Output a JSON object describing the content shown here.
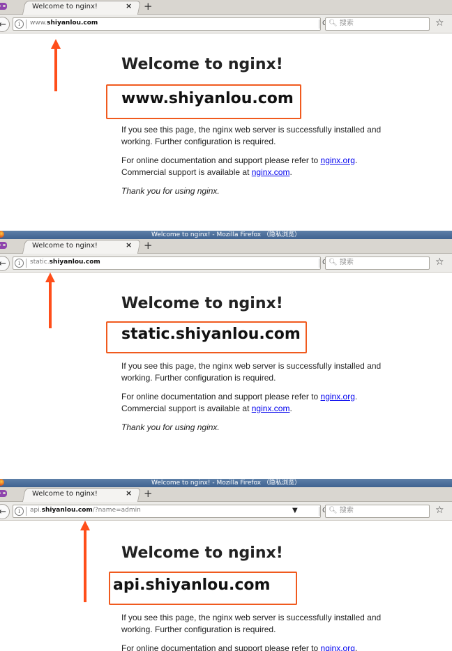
{
  "colors": {
    "arrow": "#ff4e1a",
    "box_border": "#f05a1e",
    "link": "#0000ee",
    "titlebar": "#4a6d9a"
  },
  "browser": {
    "window_title": "Welcome to nginx! - Mozilla Firefox （隐私浏览）",
    "tab_label": "Welcome to nginx!",
    "tab_close": "×",
    "new_tab": "+",
    "back": "←",
    "info": "i",
    "reload": "C",
    "search_placeholder": "搜索",
    "search_icon": "magnifier-icon",
    "star": "☆",
    "dropdown": "▼"
  },
  "page": {
    "heading": "Welcome to nginx!",
    "p1_line1": "If you see this page, the nginx web server is successfully installed and",
    "p1_line2": "working. Further configuration is required.",
    "p2_text1": "For online documentation and support please refer to ",
    "p2_link1": "nginx.org",
    "p2_text2": ".",
    "p3_text1": "Commercial support is available at ",
    "p3_link": "nginx.com",
    "p3_text2": ".",
    "thanks": "Thank you for using nginx."
  },
  "panels": [
    {
      "url_prefix": "www.",
      "url_domain": "shiyanlou.com",
      "url_suffix": "",
      "host": "www.shiyanlou.com"
    },
    {
      "url_prefix": "static.",
      "url_domain": "shiyanlou.com",
      "url_suffix": "",
      "host": "static.shiyanlou.com"
    },
    {
      "url_prefix": "api.",
      "url_domain": "shiyanlou.com",
      "url_suffix": "/?name=admin",
      "host": "api.shiyanlou.com"
    }
  ]
}
